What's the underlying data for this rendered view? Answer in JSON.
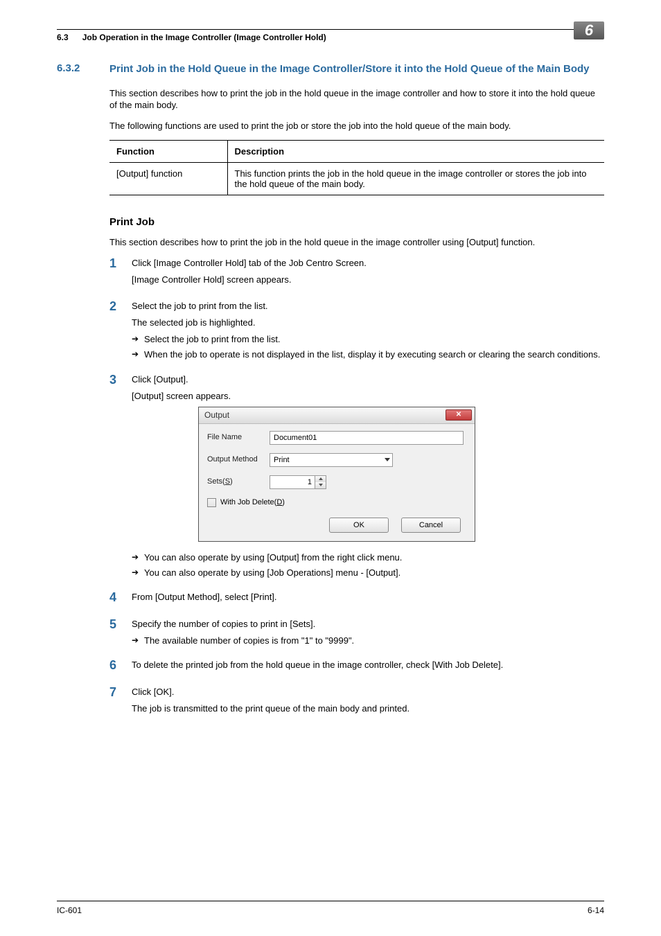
{
  "header": {
    "section_ref": "6.3",
    "section_text": "Job Operation in the Image Controller (Image Controller Hold)",
    "chapter": "6"
  },
  "section": {
    "number": "6.3.2",
    "title": "Print Job in the Hold Queue in the Image Controller/Store it into the Hold Queue of the Main Body",
    "intro1": "This section describes how to print the job in the hold queue in the image controller and how to store it into the hold queue of the main body.",
    "intro2": "The following functions are used to print the job or store the job into the hold queue of the main body."
  },
  "table": {
    "head_function": "Function",
    "head_description": "Description",
    "row1_func": "[Output] function",
    "row1_desc": "This function prints the job in the hold queue in the image controller or stores the job into the hold queue of the main body."
  },
  "printjob": {
    "heading": "Print Job",
    "intro": "This section describes how to print the job in the hold queue in the image controller using [Output] function."
  },
  "steps": {
    "s1": {
      "num": "1",
      "line1": "Click [Image Controller Hold] tab of the Job Centro Screen.",
      "line2": "[Image Controller Hold] screen appears."
    },
    "s2": {
      "num": "2",
      "line1": "Select the job to print from the list.",
      "line2": "The selected job is highlighted.",
      "note1": "Select the job to print from the list.",
      "note2": "When the job to operate is not displayed in the list, display it by executing search or clearing the search conditions."
    },
    "s3": {
      "num": "3",
      "line1": "Click [Output].",
      "line2": "[Output] screen appears.",
      "note1": "You can also operate by using [Output] from the right click menu.",
      "note2": "You can also operate by using [Job Operations] menu - [Output]."
    },
    "s4": {
      "num": "4",
      "line1": "From [Output Method], select [Print]."
    },
    "s5": {
      "num": "5",
      "line1": "Specify the number of copies to print in [Sets].",
      "note1": "The available number of copies is from \"1\" to \"9999\"."
    },
    "s6": {
      "num": "6",
      "line1": "To delete the printed job from the hold queue in the image controller, check [With Job Delete]."
    },
    "s7": {
      "num": "7",
      "line1": "Click [OK].",
      "line2": "The job is transmitted to the print queue of the main body and printed."
    }
  },
  "dialog": {
    "title": "Output",
    "close": "✕",
    "label_filename": "File Name",
    "val_filename": "Document01",
    "label_method": "Output Method",
    "val_method": "Print",
    "label_sets_pre": "Sets(",
    "label_sets_u": "S",
    "label_sets_post": ")",
    "val_sets": "1",
    "label_delete_pre": "With Job Delete(",
    "label_delete_u": "D",
    "label_delete_post": ")",
    "btn_ok": "OK",
    "btn_cancel": "Cancel"
  },
  "footer": {
    "left": "IC-601",
    "right": "6-14"
  }
}
